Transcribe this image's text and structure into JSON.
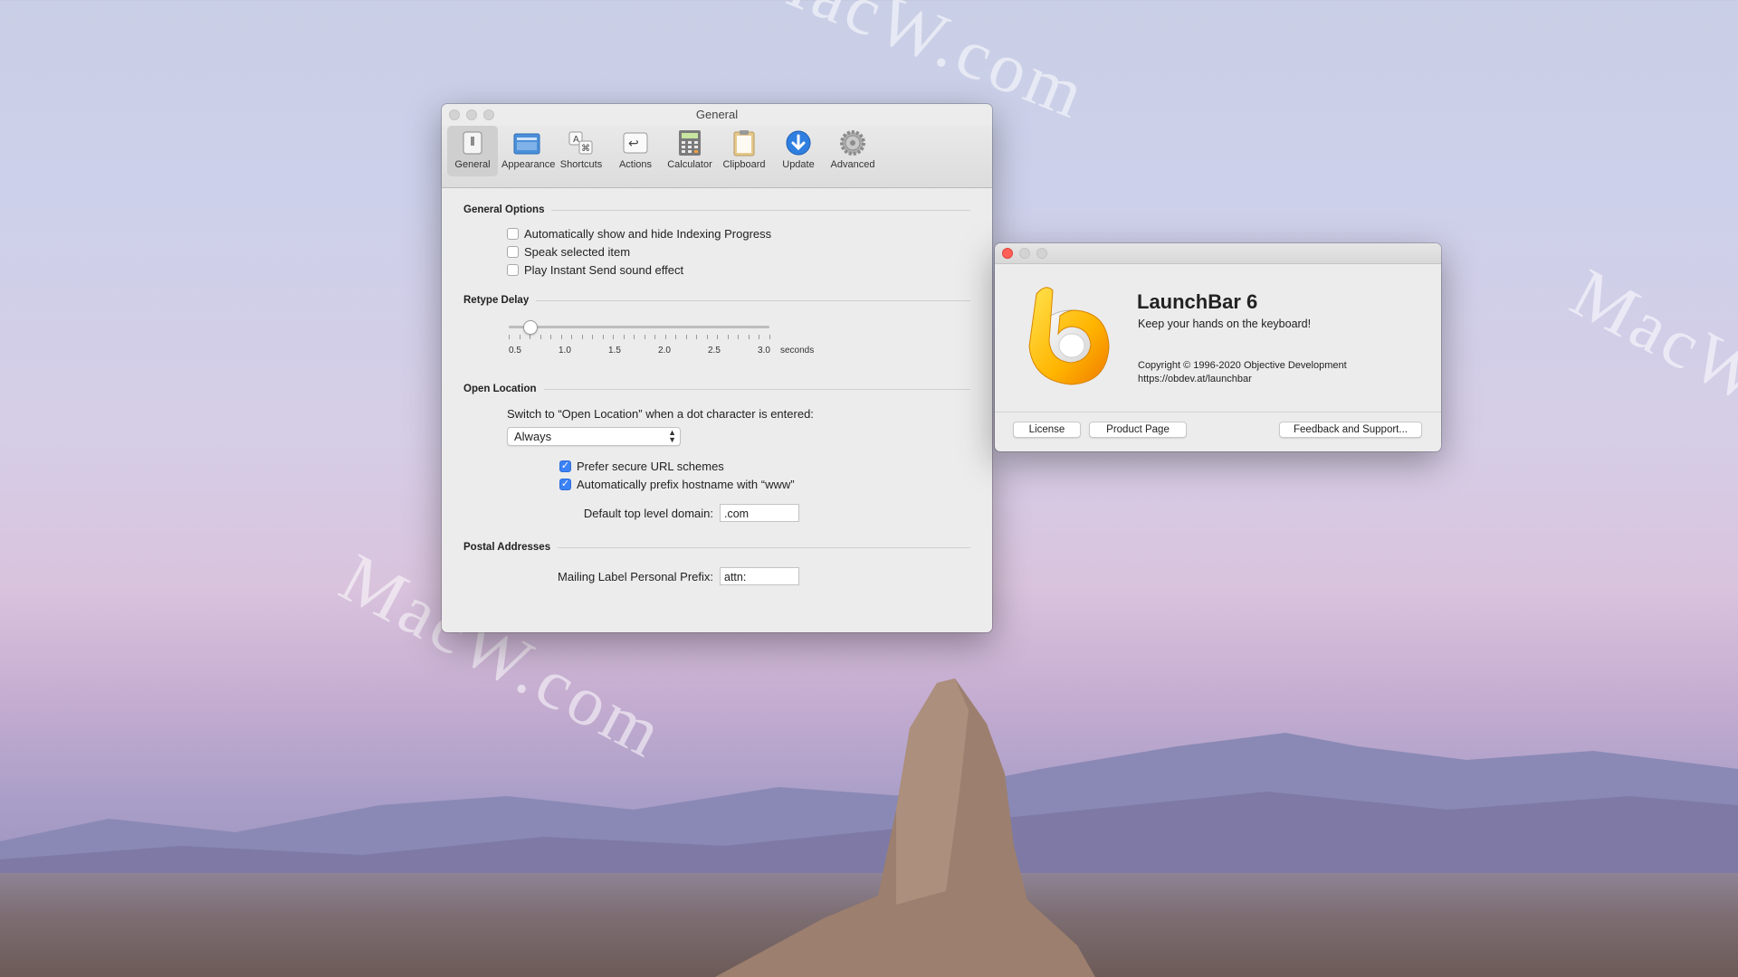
{
  "desktop": {
    "watermarks": [
      "MacW.com",
      "MacW.com",
      "MacW.com"
    ]
  },
  "prefs_window": {
    "title": "General",
    "toolbar": [
      {
        "label": "General",
        "icon": "general-icon",
        "active": true
      },
      {
        "label": "Appearance",
        "icon": "appearance-icon"
      },
      {
        "label": "Shortcuts",
        "icon": "shortcuts-icon"
      },
      {
        "label": "Actions",
        "icon": "actions-icon"
      },
      {
        "label": "Calculator",
        "icon": "calculator-icon"
      },
      {
        "label": "Clipboard",
        "icon": "clipboard-icon"
      },
      {
        "label": "Update",
        "icon": "update-icon"
      },
      {
        "label": "Advanced",
        "icon": "gear-icon"
      }
    ],
    "general_options": {
      "title": "General Options",
      "items": [
        {
          "label": "Automatically show and hide Indexing Progress",
          "checked": false
        },
        {
          "label": "Speak selected item",
          "checked": false
        },
        {
          "label": "Play Instant Send sound effect",
          "checked": false
        }
      ]
    },
    "retype_delay": {
      "title": "Retype Delay",
      "tick_labels": [
        "0.5",
        "1.0",
        "1.5",
        "2.0",
        "2.5",
        "3.0"
      ],
      "unit": "seconds",
      "value": 0.7,
      "min": 0.5,
      "max": 3.0
    },
    "open_location": {
      "title": "Open Location",
      "prompt": "Switch to “Open Location” when a dot character is entered:",
      "selected": "Always",
      "checks": [
        {
          "label": "Prefer secure URL schemes",
          "checked": true
        },
        {
          "label": "Automatically prefix hostname with “www”",
          "checked": true
        }
      ],
      "tld_label": "Default top level domain:",
      "tld_value": ".com"
    },
    "postal": {
      "title": "Postal Addresses",
      "prefix_label": "Mailing Label Personal Prefix:",
      "prefix_value": "attn:"
    }
  },
  "about_window": {
    "app_name": "LaunchBar 6",
    "tagline": "Keep your hands on the keyboard!",
    "copyright": "Copyright © 1996-2020 Objective Development",
    "url": "https://obdev.at/launchbar",
    "buttons": {
      "license": "License",
      "product_page": "Product Page",
      "feedback": "Feedback and Support..."
    }
  },
  "colors": {
    "accent": "#3b82f6",
    "close_red": "#ff5f57"
  }
}
